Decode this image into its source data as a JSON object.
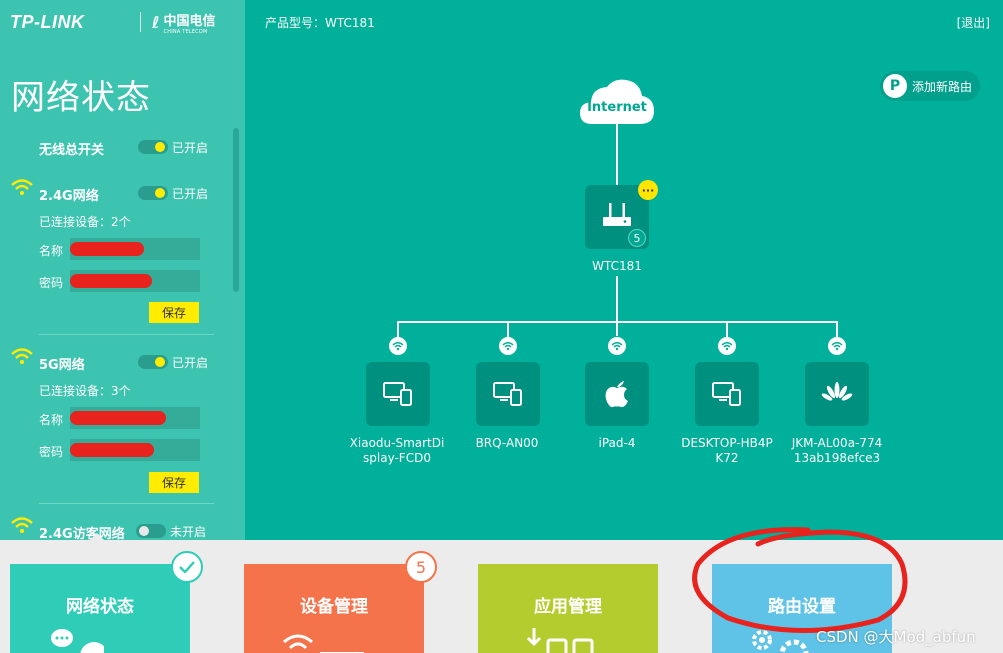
{
  "header": {
    "brand": "TP-LINK",
    "telecom_cn": "中国电信",
    "telecom_en": "CHINA TELECOM",
    "model_label": "产品型号：WTC181",
    "logout_label": "[退出]"
  },
  "left_panel": {
    "title": "网络状态",
    "master_switch": {
      "label": "无线总开关",
      "state": "已开启"
    },
    "networks": [
      {
        "name": "2.4G网络",
        "state": "已开启",
        "connected": "已连接设备：2个",
        "name_label": "名称",
        "pwd_label": "密码",
        "save_label": "保存"
      },
      {
        "name": "5G网络",
        "state": "已开启",
        "connected": "已连接设备：3个",
        "name_label": "名称",
        "pwd_label": "密码",
        "save_label": "保存"
      }
    ],
    "guest": {
      "name": "2.4G访客网络",
      "state": "未开启"
    }
  },
  "topology": {
    "internet_label": "Internet",
    "router_name": "WTC181",
    "router_count": "5",
    "more_label": "···",
    "add_router_label": "添加新路由",
    "devices": [
      {
        "name_line1": "Xiaodu-SmartDi",
        "name_line2": "splay-FCD0",
        "icon": "device-icon"
      },
      {
        "name_line1": "BRQ-AN00",
        "name_line2": "",
        "icon": "device-icon"
      },
      {
        "name_line1": "iPad-4",
        "name_line2": "",
        "icon": "apple-icon"
      },
      {
        "name_line1": "DESKTOP-HB4P",
        "name_line2": "K72",
        "icon": "device-icon"
      },
      {
        "name_line1": "JKM-AL00a-774",
        "name_line2": "13ab198efce3",
        "icon": "huawei-icon"
      }
    ]
  },
  "tiles": [
    {
      "label": "网络状态",
      "color": "#2fcdb8"
    },
    {
      "label": "设备管理",
      "color": "#f4734a",
      "count": "5"
    },
    {
      "label": "应用管理",
      "color": "#b4cc2e"
    },
    {
      "label": "路由设置",
      "color": "#5ec3e6"
    }
  ],
  "watermark": "CSDN @大Mod_abfun",
  "colors": {
    "bg": "#00b09a",
    "panel": "#3dc4b0",
    "accent_yellow": "#ffec00",
    "annotation_red": "#e8221c"
  }
}
